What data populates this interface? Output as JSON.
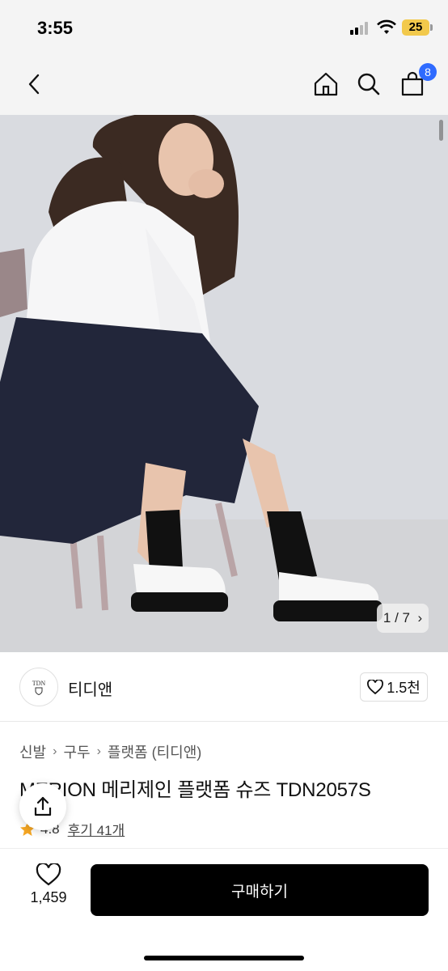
{
  "status_bar": {
    "time": "3:55",
    "battery": "25"
  },
  "nav": {
    "cart_count": "8"
  },
  "gallery": {
    "counter": "1 / 7"
  },
  "brand": {
    "logo_text": "TDN",
    "name": "티디앤",
    "likes": "1.5천"
  },
  "breadcrumb": [
    "신발",
    "구두",
    "플랫폼 (티디앤)"
  ],
  "product": {
    "title": "MERION 메리제인 플랫폼 슈즈 TDN2057S",
    "rating": "4.8",
    "reviews": "후기 41개"
  },
  "bottom": {
    "like_count": "1,459",
    "buy_label": "구매하기"
  },
  "colors": {
    "accent_badge": "#2f6bff",
    "star": "#f5a623",
    "buy_button": "#000000"
  }
}
